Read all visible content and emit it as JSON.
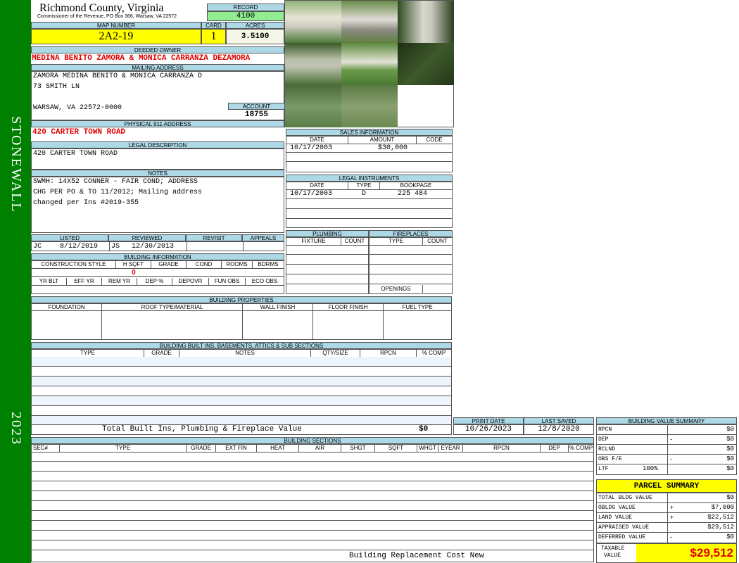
{
  "sidebar": {
    "district": "STONEWALL",
    "year": "2023",
    "color": "#008000"
  },
  "header": {
    "county": "Richmond County, Virginia",
    "commissioner": "Commissioner of the Revenue, PO Box 366, Warsaw, VA 22572",
    "record_label": "RECORD",
    "record": "4100",
    "map_number_label": "MAP NUMBER",
    "map_number": "2A2-19",
    "card_label": "CARD",
    "card": "1",
    "acres_label": "ACRES",
    "acres": "3.5100"
  },
  "owner": {
    "deeded_label": "DEEDED OWNER",
    "deeded": "MEDINA BENITO ZAMORA & MONICA CARRANZA DEZAMORA",
    "mailing_label": "MAILING ADDRESS",
    "mailing_line1": "ZAMORA MEDINA BENITO & MONICA CARRANZA D",
    "mailing_line2": "73 SMITH LN",
    "mailing_line3": "WARSAW, VA 22572-0000",
    "account_label": "ACCOUNT",
    "account": "18755",
    "physical_label": "PHYSICAL 911 ADDRESS",
    "physical": "420 CARTER TOWN ROAD",
    "legal_label": "LEGAL DESCRIPTION",
    "legal": "420 CARTER TOWN ROAD",
    "notes_label": "NOTES",
    "notes_line1": "SWMH: 14X52 CONNER - FAIR COND; ADDRESS",
    "notes_line2": "CHG PER PO & TO 11/2012; Mailing address",
    "notes_line3": "changed per Ins #2019-355"
  },
  "review": {
    "listed_label": "LISTED",
    "reviewed_label": "REVIEWED",
    "revisit_label": "REVISIT",
    "appeals_label": "APPEALS",
    "listed_by": "JC",
    "listed_date": "8/12/2019",
    "reviewed_by": "JS",
    "reviewed_date": "12/30/2013"
  },
  "building_info": {
    "title": "BUILDING INFORMATION",
    "row1": [
      "CONSTRUCTION STYLE",
      "H SQFT",
      "GRADE",
      "COND",
      "ROOMS",
      "BDRMS"
    ],
    "hsqft": "0",
    "row2": [
      "YR BLT",
      "EFF YR",
      "REM YR",
      "DEP %",
      "DEPOVR",
      "FUN OBS",
      "ECO OBS"
    ]
  },
  "sales": {
    "title": "SALES INFORMATION",
    "cols": [
      "DATE",
      "AMOUNT",
      "CODE"
    ],
    "date": "10/17/2003",
    "amount": "$30,000"
  },
  "legal_instruments": {
    "title": "LEGAL INSTRUMENTS",
    "cols": [
      "DATE",
      "TYPE",
      "BOOKPAGE"
    ],
    "date": "10/17/2003",
    "type": "D",
    "bookpage": "225 484"
  },
  "plumbing": {
    "title": "PLUMBING",
    "cols": [
      "FIXTURE",
      "COUNT"
    ]
  },
  "fireplaces": {
    "title": "FIREPLACES",
    "cols": [
      "TYPE",
      "COUNT"
    ],
    "openings": "OPENINGS"
  },
  "properties": {
    "title": "BUILDING PROPERTIES",
    "cols": [
      "FOUNDATION",
      "ROOF TYPE/MATERIAL",
      "WALL FINISH",
      "FLOOR FINISH",
      "FUEL TYPE"
    ]
  },
  "built_ins": {
    "title": "BUILDING BUILT INS, BASEMENTS, ATTICS & SUB SECTIONS",
    "cols": [
      "TYPE",
      "GRADE",
      "NOTES",
      "QTY/SIZE",
      "RPCN",
      "% COMP"
    ],
    "total_label": "Total Built Ins, Plumbing & Fireplace Value",
    "total": "$0"
  },
  "print": {
    "print_label": "PRINT DATE",
    "print_date": "10/26/2023",
    "saved_label": "LAST SAVED",
    "saved_date": "12/8/2020"
  },
  "sections": {
    "title": "BUILDING SECTIONS",
    "cols": [
      "SEC#",
      "TYPE",
      "GRADE",
      "EXT FIN",
      "HEAT",
      "AIR",
      "SHGT",
      "SQFT",
      "WHGT",
      "EYEAR",
      "RPCN",
      "DEP",
      "% COMP"
    ],
    "footer": "Building Replacement Cost New"
  },
  "value_summary": {
    "title": "BUILDING VALUE SUMMARY",
    "rows": [
      {
        "label": "RPCN",
        "op": "",
        "amount": "$0"
      },
      {
        "label": "DEP",
        "op": "-",
        "amount": "$0"
      },
      {
        "label": "RCLND",
        "op": "",
        "amount": "$0"
      },
      {
        "label": "OBS F/E",
        "op": "-",
        "amount": "$0"
      },
      {
        "label": "LTF",
        "pct": "100%",
        "op": "",
        "amount": "$0"
      }
    ]
  },
  "parcel_summary": {
    "title": "PARCEL SUMMARY",
    "rows": [
      {
        "label": "TOTAL BLDG VALUE",
        "op": "",
        "amount": "$0"
      },
      {
        "label": "OBLDG VALUE",
        "op": "+",
        "amount": "$7,000"
      },
      {
        "label": "LAND VALUE",
        "op": "+",
        "amount": "$22,512"
      },
      {
        "label": "APPRAISED VALUE",
        "op": "",
        "amount": "$29,512"
      },
      {
        "label": "DEFERRED VALUE",
        "op": "-",
        "amount": "$0"
      }
    ],
    "taxable_label_1": "TAXABLE",
    "taxable_label_2": "VALUE",
    "taxable": "$29,512"
  },
  "photos": [
    "house-photo",
    "carport-photo",
    "shed-photo",
    "driveway-photo",
    "mobile-home-photo",
    "woods-photo",
    "yard-photo",
    "trees-photo"
  ]
}
